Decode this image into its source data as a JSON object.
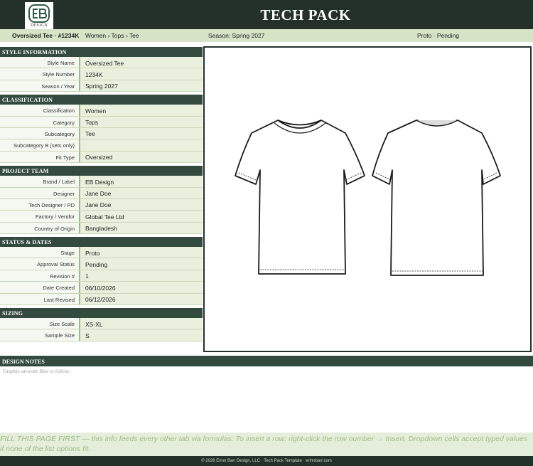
{
  "header": {
    "title": "TECH PACK",
    "logo_text": "DESIGN",
    "logo_monogram": "EB"
  },
  "subheader": {
    "style": "Oversized Tee  ·  #1234K",
    "breadcrumb": "Women  ›  Tops  ›  Tee",
    "season": "Season:  Spring 2027",
    "status": "Proto  ·  Pending"
  },
  "sections": {
    "style_info": {
      "title": "STYLE INFORMATION",
      "rows": [
        {
          "label": "Style Name",
          "value": "Oversized Tee"
        },
        {
          "label": "Style Number",
          "value": "1234K"
        },
        {
          "label": "Season / Year",
          "value": "Spring 2027"
        }
      ]
    },
    "classification": {
      "title": "CLASSIFICATION",
      "rows": [
        {
          "label": "Classification",
          "value": "Women"
        },
        {
          "label": "Category",
          "value": "Tops"
        },
        {
          "label": "Subcategory",
          "value": "Tee"
        },
        {
          "label": "Subcategory B (sets only)",
          "value": ""
        },
        {
          "label": "Fit Type",
          "value": "Oversized"
        }
      ]
    },
    "project_team": {
      "title": "PROJECT TEAM",
      "rows": [
        {
          "label": "Brand / Label",
          "value": "EB Design"
        },
        {
          "label": "Designer",
          "value": "Jane Doe"
        },
        {
          "label": "Tech Designer / PD",
          "value": "Jane Doe"
        },
        {
          "label": "Factory / Vendor",
          "value": "Global Tee Ltd"
        },
        {
          "label": "Country of Origin",
          "value": "Bangladesh"
        }
      ]
    },
    "status_dates": {
      "title": "STATUS & DATES",
      "rows": [
        {
          "label": "Stage",
          "value": "Proto"
        },
        {
          "label": "Approval Status",
          "value": "Pending"
        },
        {
          "label": "Revision #",
          "value": "1"
        },
        {
          "label": "Date Created",
          "value": "06/10/2026"
        },
        {
          "label": "Last Revised",
          "value": "06/12/2026"
        }
      ]
    },
    "sizing": {
      "title": "SIZING",
      "rows": [
        {
          "label": "Size Scale",
          "value": "XS-XL"
        },
        {
          "label": "Sample Size",
          "value": "S"
        }
      ]
    }
  },
  "design_notes": {
    "title": "DESIGN NOTES",
    "text": "Graphic artwork files to follow."
  },
  "footer": {
    "hint": "FILL THIS PAGE FIRST — this info feeds every other tab via formulas. To insert a row: right-click the row number → Insert. Dropdown cells accept typed values if none of the list options fit.",
    "copyright": "© 2026 Erinn Barr Design, LLC  ·  Tech Pack Template  ·  erinnbarr.com"
  },
  "colors": {
    "header_bg": "#24312b",
    "section_bg": "#344a3f",
    "subheader_bg": "#d7e3c7",
    "value_bg": "#e9f1de",
    "hint_text": "#9fbd86"
  }
}
